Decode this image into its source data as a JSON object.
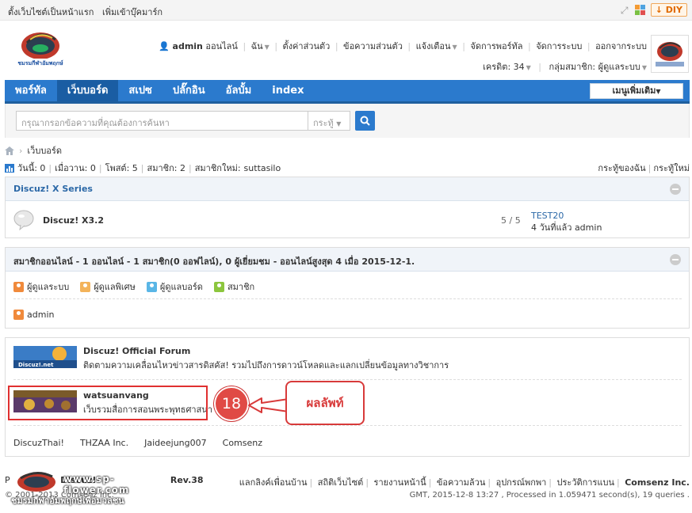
{
  "topbar": {
    "links": [
      "ตั้งเว็บไซต์เป็นหน้าแรก",
      "เพิ่มเข้าบุ๊คมาร์ก"
    ],
    "diy_label": "DIY"
  },
  "header": {
    "username": "admin",
    "online_label": "ออนไลน์",
    "menu": [
      "ฉัน",
      "ตั้งค่าส่วนตัว",
      "ข้อความส่วนตัว",
      "แจ้งเตือน",
      "จัดการพอร์ทัล",
      "จัดการระบบ",
      "ออกจากระบบ"
    ],
    "credit": "เครดิต: 34",
    "group": "กลุ่มสมาชิก: ผู้ดูแลระบบ"
  },
  "nav": {
    "items": [
      "พอร์ทัล",
      "เว็บบอร์ด",
      "สเปซ",
      "ปลั๊กอิน",
      "อัลบั้ม",
      "index"
    ],
    "active_index": 1,
    "more_label": "เมนูเพิ่มเติม"
  },
  "search": {
    "placeholder": "กรุณากรอกข้อความที่คุณต้องการค้นหา",
    "type_label": "กระทู้"
  },
  "breadcrumb": {
    "current": "เว็บบอร์ด"
  },
  "stats": {
    "today": "วันนี้: 0",
    "yesterday": "เมื่อวาน: 0",
    "posts": "โพสต์: 5",
    "members": "สมาชิก: 2",
    "newest_label": "สมาชิกใหม่:",
    "newest_user": "suttasilo",
    "my_threads": "กระทู้ของฉัน",
    "new_threads": "กระทู้ใหม่"
  },
  "category": {
    "title": "Discuz! X Series",
    "forum": {
      "name": "Discuz! X3.2",
      "count": "5 / 5",
      "last_title": "TEST20",
      "last_meta": "4 วันที่แล้ว admin"
    }
  },
  "online": {
    "title": "สมาชิกออนไลน์ - 1 ออนไลน์ - 1 สมาชิก(0 ออฟไลน์), 0 ผู้เยี่ยมชม - ออนไลน์สูงสุด 4 เมื่อ 2015-12-1.",
    "legend": [
      {
        "label": "ผู้ดูแลระบบ",
        "color": "#f08a3c"
      },
      {
        "label": "ผู้ดูแลพิเศษ",
        "color": "#f3b35a"
      },
      {
        "label": "ผู้ดูแลบอร์ด",
        "color": "#5ab6e6"
      },
      {
        "label": "สมาชิก",
        "color": "#8cc63e"
      }
    ],
    "user": "admin"
  },
  "links": {
    "items": [
      {
        "name": "Discuz! Official Forum",
        "desc": "ติดตามความเคลื่อนไหวข่าวสารดิสคัส! รวมไปถึงการดาวน์โหลดและแลกเปลี่ยนข้อมูลทางวิชาการ",
        "thumb_text": "Discuz!.net"
      },
      {
        "name": "watsuanvang",
        "desc": "เว็บรวมสื่อการสอนพระพุทธศาสนา"
      }
    ],
    "text_links": [
      "DiscuzThai!",
      "THZAA Inc.",
      "Jaideejung007",
      "Comsenz"
    ]
  },
  "annotation": {
    "number": "18",
    "callout": "ผลลัพท์"
  },
  "footer": {
    "powered_prefix": "P",
    "powered_name": "Discuz!",
    "version": "Rev.38",
    "copyright": "© 2001-2013 Comsenz Inc.",
    "links": [
      "แลกลิงค์เพื่อนบ้าน",
      "สถิติเว็บไซต์",
      "รายงานหน้านี้",
      "ข้อความล้วน",
      "อุปกรณ์พกพา",
      "ประวัติการแบน"
    ],
    "brand": "Comsenz Inc.",
    "info": "GMT, 2015-12-8 13:27 , Processed in 1.059471 second(s), 19 queries ."
  },
  "watermark": {
    "line1": "www.sp-flower.com",
    "line2": "ชมรมกีฬาอัมพฤกษ์เพื่อมวลชน"
  }
}
